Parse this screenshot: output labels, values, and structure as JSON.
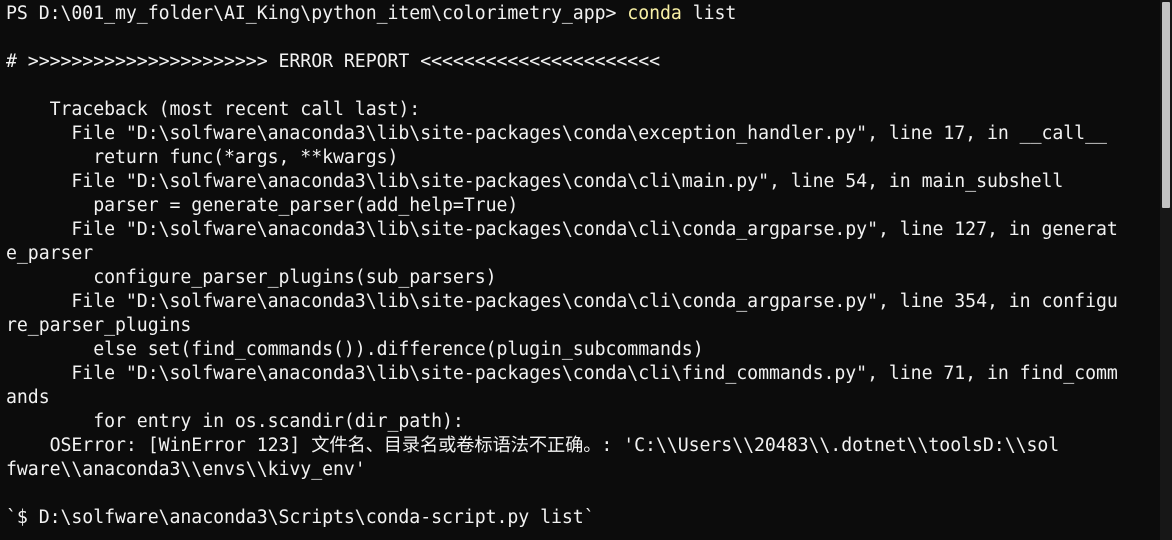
{
  "terminal": {
    "prompt": {
      "path": "PS D:\\001_my_folder\\AI_King\\python_item\\colorimetry_app> ",
      "command": "conda",
      "args": " list"
    },
    "lines": [
      "",
      "# >>>>>>>>>>>>>>>>>>>>>> ERROR REPORT <<<<<<<<<<<<<<<<<<<<<<",
      "",
      "    Traceback (most recent call last):",
      "      File \"D:\\solfware\\anaconda3\\lib\\site-packages\\conda\\exception_handler.py\", line 17, in __call__",
      "        return func(*args, **kwargs)",
      "      File \"D:\\solfware\\anaconda3\\lib\\site-packages\\conda\\cli\\main.py\", line 54, in main_subshell",
      "        parser = generate_parser(add_help=True)",
      "      File \"D:\\solfware\\anaconda3\\lib\\site-packages\\conda\\cli\\conda_argparse.py\", line 127, in generat",
      "e_parser",
      "        configure_parser_plugins(sub_parsers)",
      "      File \"D:\\solfware\\anaconda3\\lib\\site-packages\\conda\\cli\\conda_argparse.py\", line 354, in configu",
      "re_parser_plugins",
      "        else set(find_commands()).difference(plugin_subcommands)",
      "      File \"D:\\solfware\\anaconda3\\lib\\site-packages\\conda\\cli\\find_commands.py\", line 71, in find_comm",
      "ands",
      "        for entry in os.scandir(dir_path):",
      "    OSError: [WinError 123] 文件名、目录名或卷标语法不正确。: 'C:\\\\Users\\\\20483\\\\.dotnet\\\\toolsD:\\\\sol",
      "fware\\\\anaconda3\\\\envs\\\\kivy_env'",
      "",
      "`$ D:\\solfware\\anaconda3\\Scripts\\conda-script.py list`",
      ""
    ]
  },
  "colors": {
    "background": "#0c0c0c",
    "foreground": "#f2f2f2",
    "command_highlight": "#f9f1a5",
    "scrollbar_thumb": "#c2c2c2"
  }
}
